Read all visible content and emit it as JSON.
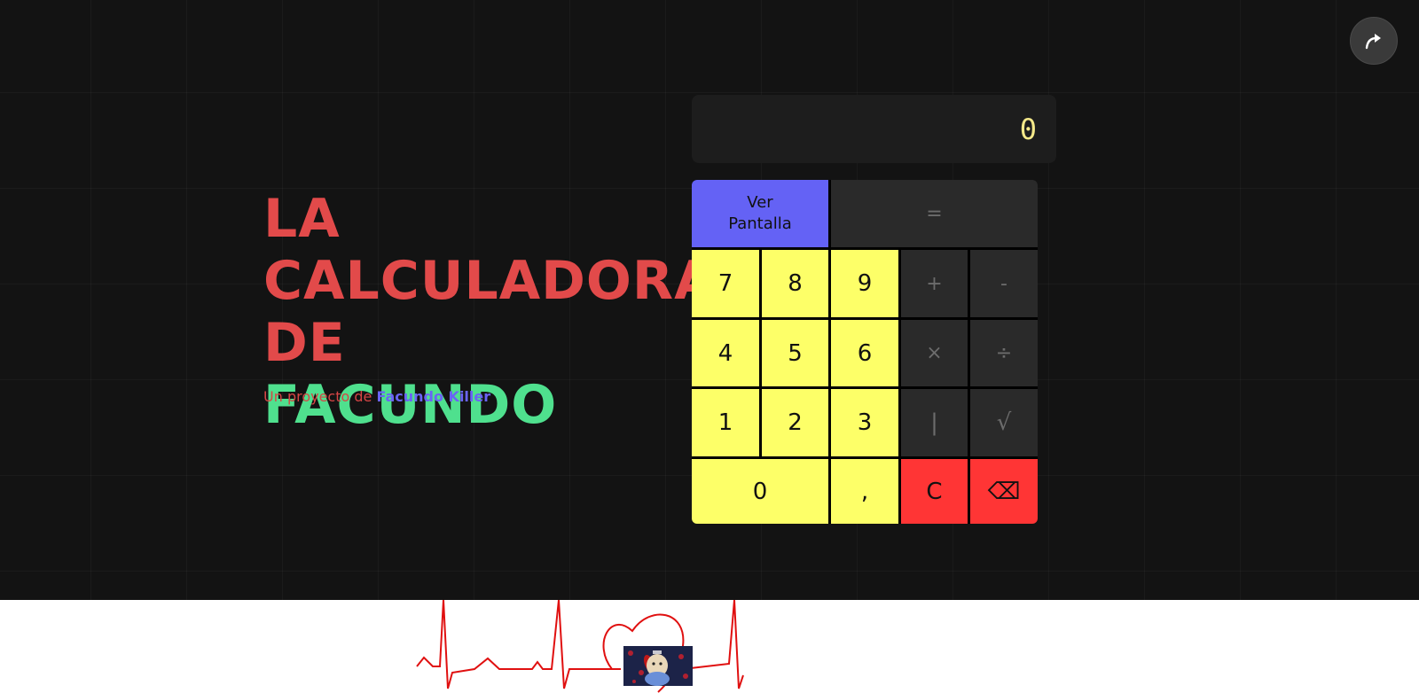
{
  "hero": {
    "title_line1": "LA",
    "title_line2": "CALCULADORA",
    "title_line3_prefix": "DE",
    "title_line3_accent": "FACUNDO",
    "subtitle_prefix": "Un proyecto de",
    "subtitle_author": "Facundo Killer"
  },
  "calculator": {
    "display_value": "0",
    "keys": {
      "view_screen_line1": "Ver",
      "view_screen_line2": "Pantalla",
      "equals": "=",
      "seven": "7",
      "eight": "8",
      "nine": "9",
      "plus": "+",
      "minus": "-",
      "four": "4",
      "five": "5",
      "six": "6",
      "multiply": "×",
      "divide": "÷",
      "one": "1",
      "two": "2",
      "three": "3",
      "bar": "|",
      "sqrt": "√",
      "zero": "0",
      "comma": ",",
      "clear": "C",
      "backspace": "⌫"
    }
  },
  "colors": {
    "background": "#131313",
    "title_red": "#e24a4a",
    "title_green": "#4fe08e",
    "author_blue": "#6a64f4",
    "key_yellow": "#fdff68",
    "key_gray": "#2a2a2a",
    "key_red": "#ff3535",
    "key_blue": "#6462f5",
    "display_text": "#f5e98a",
    "ecg_red": "#e01010"
  },
  "icons": {
    "share": "share-arrow-icon"
  }
}
